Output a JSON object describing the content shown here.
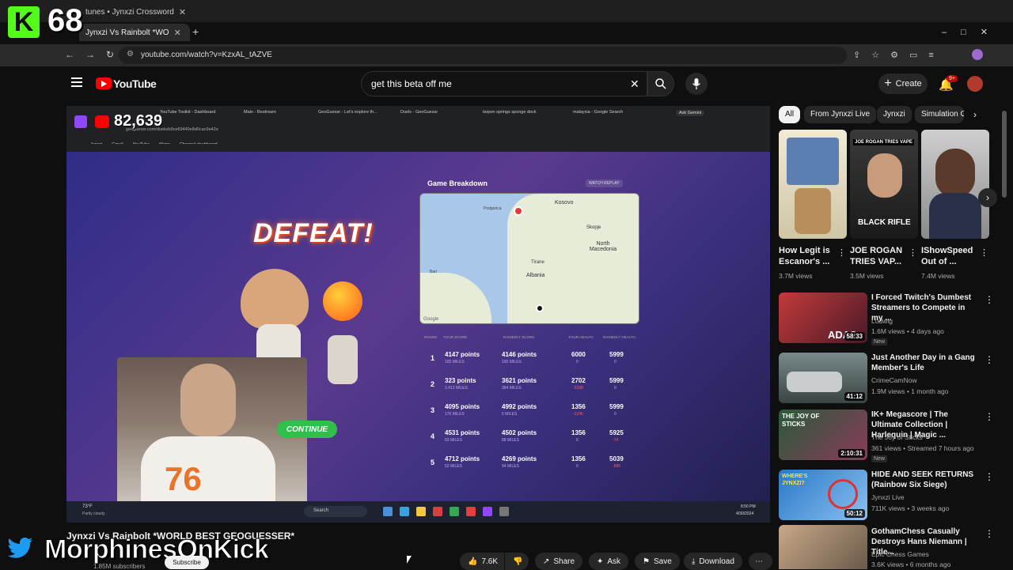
{
  "browser": {
    "tabs": [
      {
        "label": "Jynxzi Vs Rainbolt *WO"
      },
      {
        "label": "tunes • Jynxzi Crossword"
      }
    ],
    "url": "youtube.com/watch?v=KzxAL_tAZVE"
  },
  "overlay": {
    "kick_count": "68",
    "twitch_count": "82,639",
    "twitter_handle": "MorphinesOnKick"
  },
  "youtube": {
    "logo_text": "YouTube",
    "search_value": "get this beta off me",
    "create_label": "Create",
    "notif_badge": "9+"
  },
  "inner_browser": {
    "tabs": [
      "YouTube Toolkit - Dashboard",
      "Main - Restream",
      "GeoGuessr - Let's explore th...",
      "Duels - GeoGuessr",
      "tarpon springs sponge dock",
      "malaysia - Google Search"
    ],
    "ask_gemini": "Ask Gemini",
    "url": "geoguessr.com/duels/b9ce69449e8d0cac9e42e",
    "bookmarks": [
      "Jynxzi",
      "Gmail",
      "YouTube",
      "Maps",
      "Channel dashboard..."
    ]
  },
  "game": {
    "result": "DEFEAT!",
    "continue_label": "CONTINUE",
    "breakdown_title": "Game Breakdown",
    "watch_replay": "WATCH REPLAY",
    "map_labels": {
      "kosovo": "Kosovo",
      "skopje": "Skopje",
      "macedonia": "North Macedonia",
      "tirane": "Tirane",
      "albania": "Albania",
      "bari": "Bari",
      "google": "Google",
      "podgorica": "Podgorica"
    },
    "headers": [
      "ROUND",
      "YOUR SCORE",
      "RAINBOLT SCORE",
      "YOUR HEALTH",
      "RAINBOLT HEALTH"
    ],
    "rounds": [
      {
        "n": "1",
        "your": "4147 points",
        "your_sub": "165 MILES",
        "rb": "4146 points",
        "rb_sub": "165 MILES",
        "yh": "6000",
        "yh_sub": "0",
        "rh": "5999",
        "rh_sub": "0"
      },
      {
        "n": "2",
        "your": "323 points",
        "your_sub": "2,413 MILES",
        "rb": "3621 points",
        "rb_sub": "384 MILES",
        "yh": "2702",
        "yh_sub": "-3298",
        "rh": "5999",
        "rh_sub": "0"
      },
      {
        "n": "3",
        "your": "4095 points",
        "your_sub": "176 MILES",
        "rb": "4992 points",
        "rb_sub": "5 MILES",
        "yh": "1356",
        "yh_sub": "-1346",
        "rh": "5999",
        "rh_sub": "0"
      },
      {
        "n": "4",
        "your": "4531 points",
        "your_sub": "83 MILES",
        "rb": "4502 points",
        "rb_sub": "88 MILES",
        "yh": "1356",
        "yh_sub": "0",
        "rh": "5925",
        "rh_sub": "-74"
      },
      {
        "n": "5",
        "your": "4712 points",
        "your_sub": "52 MILES",
        "rb": "4269 points",
        "rb_sub": "94 MILES",
        "yh": "1356",
        "yh_sub": "0",
        "rh": "5039",
        "rh_sub": "-886"
      }
    ],
    "taskbar": {
      "weather": "73°F",
      "weather_sub": "Partly cloudy",
      "search": "Search",
      "time": "8:50 PM",
      "date": "4/30/2024"
    }
  },
  "video_info": {
    "title": "Jynxzi Vs Rainbolt *WORLD BEST GEOGUESSER*",
    "subscribers": "1.85M subscribers",
    "subscribe": "Subscribe",
    "likes": "7.6K",
    "share": "Share",
    "ask": "Ask",
    "save": "Save",
    "download": "Download"
  },
  "sidebar": {
    "chips": [
      "All",
      "From Jynxzi Live",
      "Jynxzi",
      "Simulation G"
    ],
    "shorts": [
      {
        "title": "How Legit is Escanor's ...",
        "views": "3.7M views"
      },
      {
        "title": "JOE ROGAN TRIES VAP...",
        "views": "3.5M views",
        "overlay": "JOE ROGAN TRIES VAPE",
        "overlay2": "BLACK RIFLE"
      },
      {
        "title": "IShowSpeed Out of ...",
        "views": "7.4M views"
      }
    ],
    "videos": [
      {
        "title": "I Forced Twitch's Dumbest Streamers to Compete in my ...",
        "channel": "Ludwig",
        "meta": "1.6M views • 4 days ago",
        "badge": "New",
        "duration": "58:33",
        "thumb_text": "ADA?"
      },
      {
        "title": "Just Another Day in a Gang Member's Life",
        "channel": "CrimeCamNow",
        "meta": "1.9M views • 1 month ago",
        "badge": "",
        "duration": "41:12",
        "thumb_text": ""
      },
      {
        "title": "IK+ Megascore | The Ultimate Collection | Harlequin | Magic ...",
        "channel": "The Joy of Sticks",
        "meta": "361 views • Streamed 7 hours ago",
        "badge": "New",
        "duration": "2:10:31",
        "thumb_text": "THE JOY OF STICKS"
      },
      {
        "title": "HIDE AND SEEK RETURNS (Rainbow Six Siege)",
        "channel": "Jynxzi Live",
        "meta": "711K views • 3 weeks ago",
        "badge": "",
        "duration": "50:12",
        "thumb_text": "WHERE'S JYNXZI?"
      },
      {
        "title": "GothamChess Casually Destroys Hans Niemann | Title...",
        "channel": "Epic Chess Games",
        "meta": "3.6K views • 6 months ago",
        "badge": "",
        "duration": "",
        "thumb_text": ""
      }
    ]
  },
  "colors": {
    "youtube_red": "#ff0000",
    "kick_green": "#53fc18",
    "twitch_purple": "#9146ff",
    "twitter_blue": "#1d9bf0",
    "continue_green": "#2fbf4a",
    "defeat_orange": "#ff6a2a"
  }
}
